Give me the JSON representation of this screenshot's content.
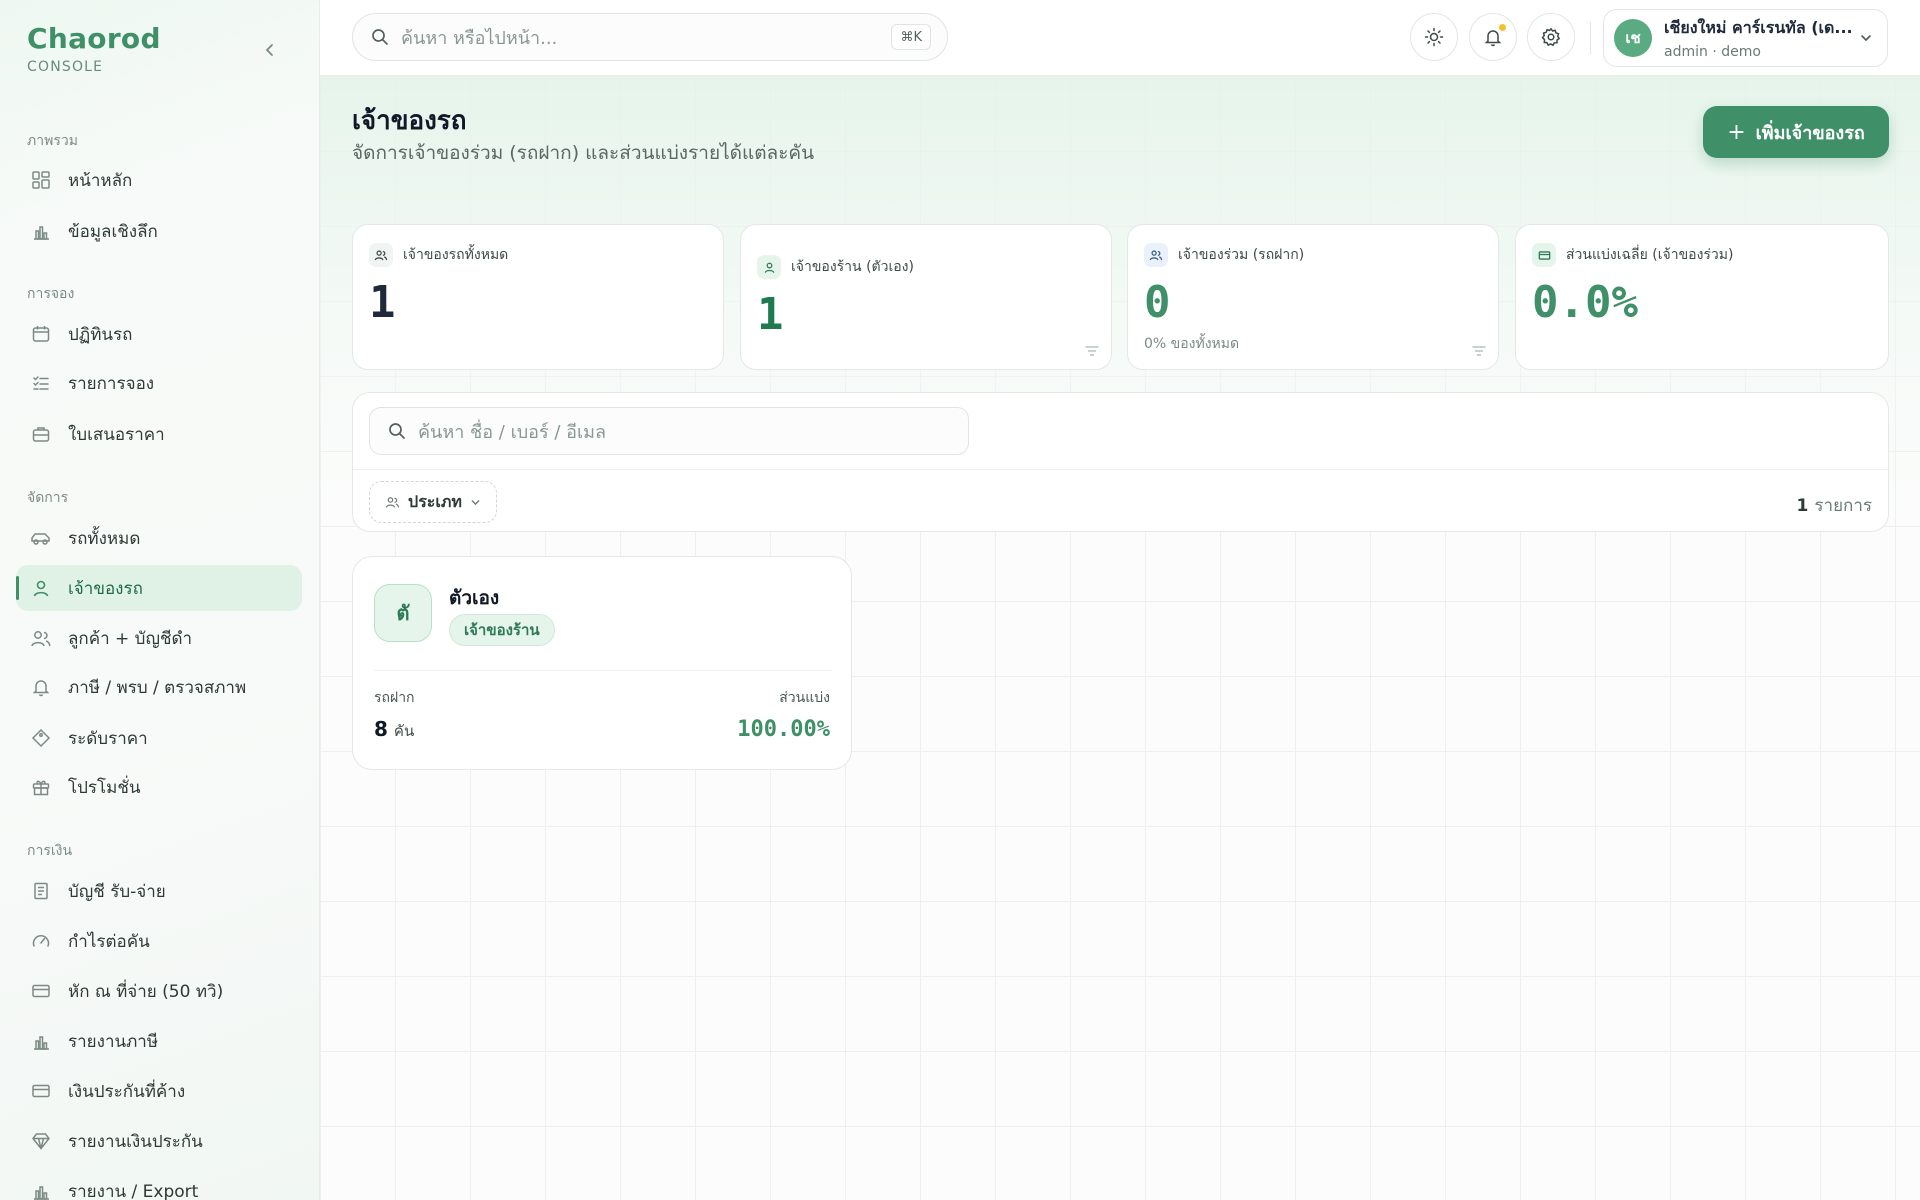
{
  "brand": {
    "name": "Chaorod",
    "subtitle": "CONSOLE"
  },
  "sidebar": {
    "sections": [
      {
        "label": "ภาพรวม",
        "items": [
          {
            "label": "หน้าหลัก",
            "icon": "dashboard-icon"
          },
          {
            "label": "ข้อมูลเชิงลึก",
            "icon": "chart-icon"
          }
        ]
      },
      {
        "label": "การจอง",
        "items": [
          {
            "label": "ปฏิทินรถ",
            "icon": "calendar-icon"
          },
          {
            "label": "รายการจอง",
            "icon": "list-icon"
          },
          {
            "label": "ใบเสนอราคา",
            "icon": "briefcase-icon"
          }
        ]
      },
      {
        "label": "จัดการ",
        "items": [
          {
            "label": "รถทั้งหมด",
            "icon": "car-icon"
          },
          {
            "label": "เจ้าของรถ",
            "icon": "user-icon",
            "active": true
          },
          {
            "label": "ลูกค้า + บัญชีดำ",
            "icon": "users-icon"
          },
          {
            "label": "ภาษี / พรบ / ตรวจสภาพ",
            "icon": "bell-icon"
          },
          {
            "label": "ระดับราคา",
            "icon": "tag-icon"
          },
          {
            "label": "โปรโมชั่น",
            "icon": "gift-icon"
          }
        ]
      },
      {
        "label": "การเงิน",
        "items": [
          {
            "label": "บัญชี รับ-จ่าย",
            "icon": "receipt-icon"
          },
          {
            "label": "กำไรต่อคัน",
            "icon": "gauge-icon"
          },
          {
            "label": "หัก ณ ที่จ่าย (50 ทวิ)",
            "icon": "card-icon"
          },
          {
            "label": "รายงานภาษี",
            "icon": "chart-icon"
          },
          {
            "label": "เงินประกันที่ค้าง",
            "icon": "card-icon"
          },
          {
            "label": "รายงานเงินประกัน",
            "icon": "diamond-icon"
          },
          {
            "label": "รายงาน / Export",
            "icon": "chart-icon"
          }
        ]
      }
    ]
  },
  "topbar": {
    "search_placeholder": "ค้นหา หรือไปหน้า...",
    "shortcut": "⌘K",
    "user": {
      "initials": "เช",
      "name": "เชียงใหม่ คาร์เรนทัล (เด...",
      "role": "admin · demo"
    }
  },
  "page": {
    "title": "เจ้าของรถ",
    "subtitle": "จัดการเจ้าของร่วม (รถฝาก) และส่วนแบ่งรายได้แต่ละคัน",
    "add_button": "เพิ่มเจ้าของรถ"
  },
  "stats": [
    {
      "label": "เจ้าของรถทั้งหมด",
      "value": "1",
      "color": "#1e293b"
    },
    {
      "label": "เจ้าของร้าน (ตัวเอง)",
      "value": "1",
      "color": "#1f7a4f"
    },
    {
      "label": "เจ้าของร่วม (รถฝาก)",
      "value": "0",
      "foot": "0% ของทั้งหมด",
      "color": "#3f8f68"
    },
    {
      "label": "ส่วนแบ่งเฉลี่ย (เจ้าของร่วม)",
      "value": "0.0%",
      "color": "#3f8f68"
    }
  ],
  "filters": {
    "search_placeholder": "ค้นหา ชื่อ / เบอร์ / อีเมล",
    "type_label": "ประเภท",
    "count": "1",
    "count_unit": "รายการ"
  },
  "owners": [
    {
      "initial": "ตั",
      "name": "ตัวเอง",
      "badge": "เจ้าของร้าน",
      "cars_label": "รถฝาก",
      "cars_value": "8",
      "cars_unit": "คัน",
      "share_label": "ส่วนแบ่ง",
      "share_value": "100.00%"
    }
  ]
}
